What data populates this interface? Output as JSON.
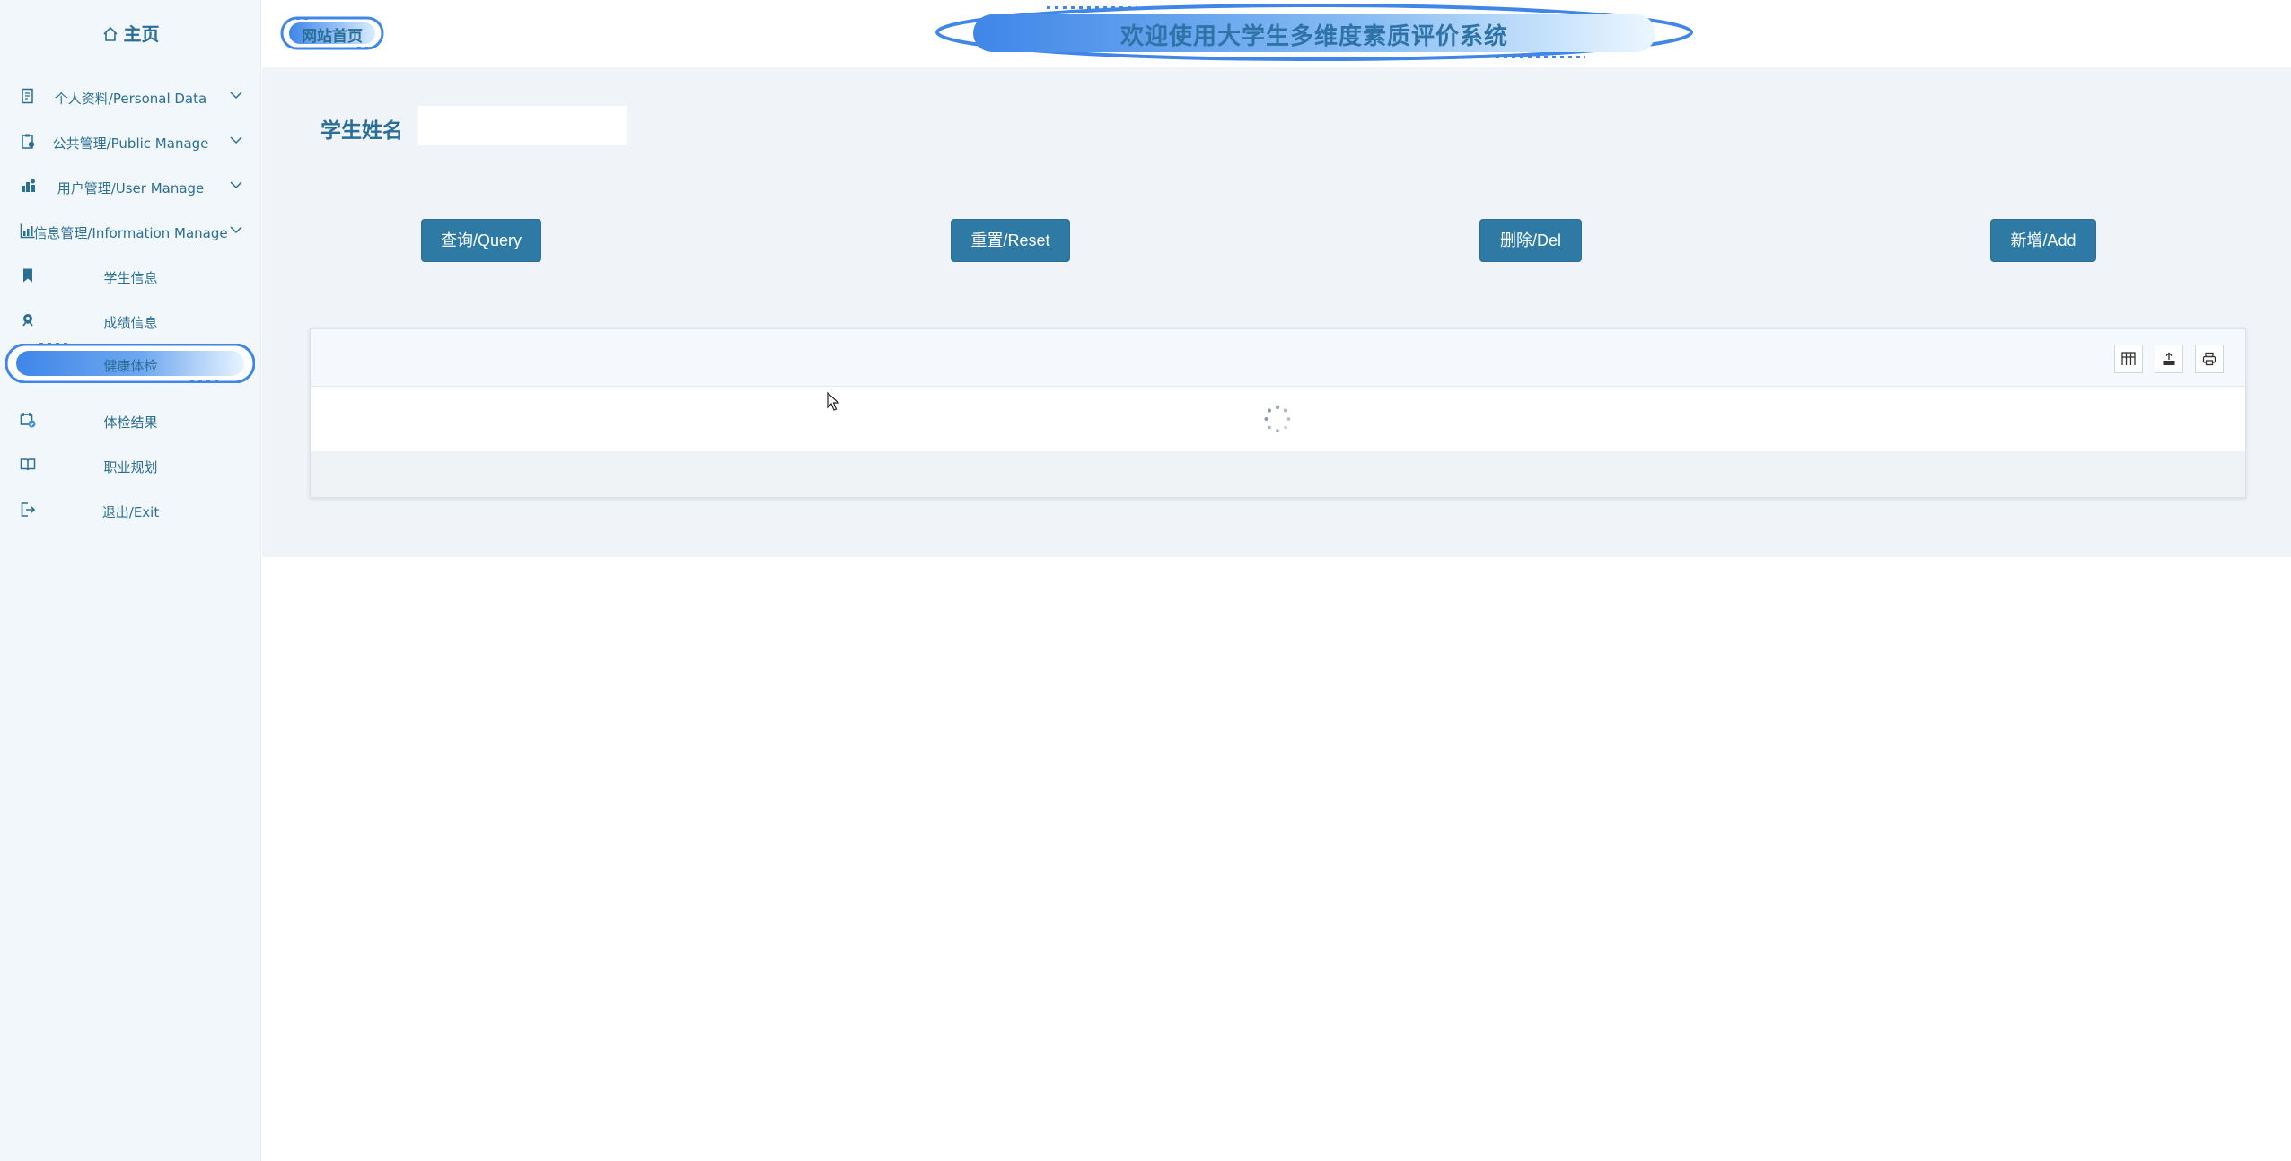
{
  "sidebar": {
    "home_label": "主页",
    "items": [
      {
        "label": "个人资料/Personal Data",
        "icon": "document-icon",
        "expandable": true
      },
      {
        "label": "公共管理/Public Manage",
        "icon": "clipboard-icon",
        "expandable": true
      },
      {
        "label": "用户管理/User Manage",
        "icon": "users-chart-icon",
        "expandable": true
      },
      {
        "label": "信息管理/Information Manage",
        "icon": "bar-chart-icon",
        "expandable": true
      },
      {
        "label": "学生信息",
        "icon": "bookmark-icon"
      },
      {
        "label": "成绩信息",
        "icon": "award-icon"
      },
      {
        "label": "健康体检",
        "icon": "none",
        "active": true
      },
      {
        "label": "体检结果",
        "icon": "calendar-check-icon"
      },
      {
        "label": "职业规划",
        "icon": "open-book-icon"
      },
      {
        "label": "退出/Exit",
        "icon": "logout-icon"
      }
    ]
  },
  "header": {
    "site_home_label": "网站首页",
    "banner_title": "欢迎使用大学生多维度素质评价系统"
  },
  "search": {
    "label": "学生姓名",
    "value": "",
    "placeholder": ""
  },
  "actions": {
    "query": "查询/Query",
    "reset": "重置/Reset",
    "delete": "删除/Del",
    "add": "新增/Add"
  },
  "table": {
    "state": "loading",
    "toolbar_icons": [
      "columns-icon",
      "export-icon",
      "print-icon"
    ]
  },
  "colors": {
    "accent": "#2f7aa4",
    "text": "#2a6f97",
    "sidebar_bg": "#f2f7fc",
    "content_bg": "#f0f4f8",
    "pill_gradient_start": "#3f86e8",
    "pill_gradient_end": "#e8f4ff"
  }
}
